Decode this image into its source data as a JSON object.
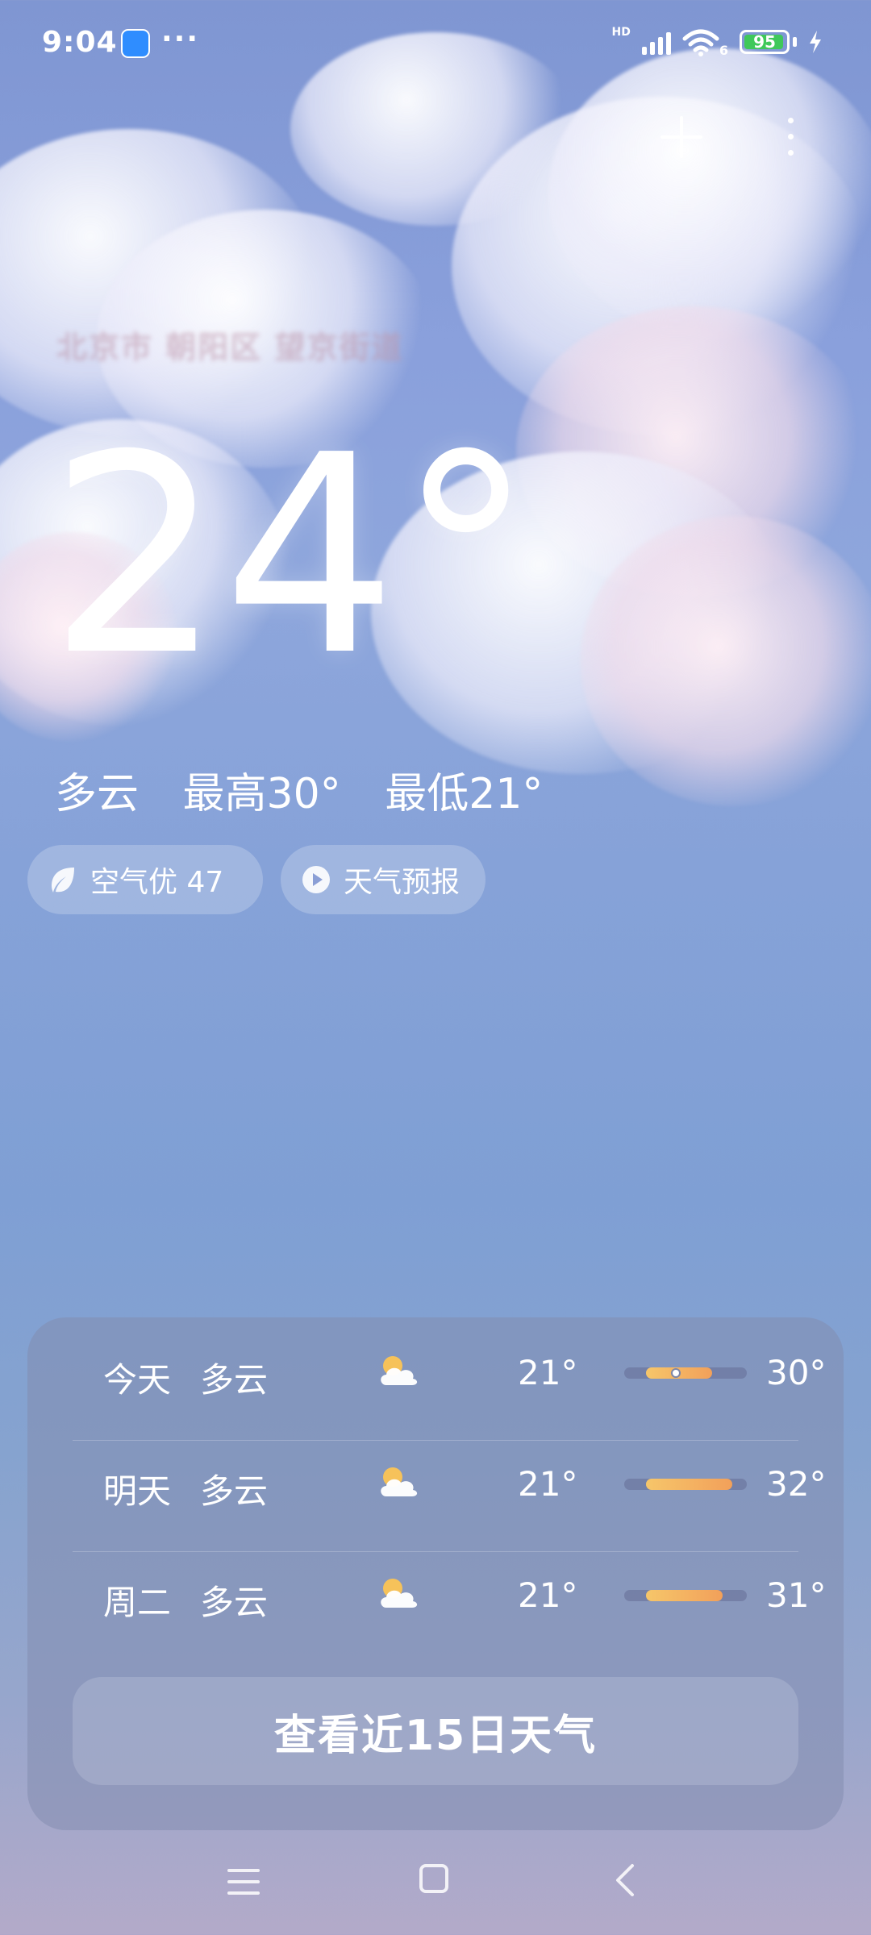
{
  "status_bar": {
    "time": "9:04",
    "dots": "···",
    "network_label": "HD",
    "wifi_label": "6",
    "battery_level": "95"
  },
  "location": {
    "name": "北京市 朝阳区 望京街道"
  },
  "current": {
    "temperature": "24°",
    "condition": "多云",
    "high": "最高30°",
    "low": "最低21°"
  },
  "pills": {
    "air_quality": "空气优 47",
    "forecast_video": "天气预报"
  },
  "forecast": {
    "rows": [
      {
        "day": "今天",
        "condition": "多云",
        "low": "21°",
        "high": "30°",
        "range_start": 0.18,
        "range_end": 0.72,
        "current_marker": 0.42
      },
      {
        "day": "明天",
        "condition": "多云",
        "low": "21°",
        "high": "32°",
        "range_start": 0.18,
        "range_end": 0.88
      },
      {
        "day": "周二",
        "condition": "多云",
        "low": "21°",
        "high": "31°",
        "range_start": 0.18,
        "range_end": 0.8
      }
    ],
    "fifteen_day_button": "查看近15日天气"
  },
  "colors": {
    "sky_top": "#7f96d2",
    "sky_bottom": "#b3aac9",
    "bar_fill_start": "#f6c66a",
    "bar_fill_end": "#f2a05a",
    "battery_fill": "#3fc85a"
  },
  "icons": {
    "air_quality": "leaf-icon",
    "forecast_video": "play-icon",
    "weather": "partly-cloudy-icon",
    "add": "plus-icon",
    "more": "more-vertical-icon"
  }
}
